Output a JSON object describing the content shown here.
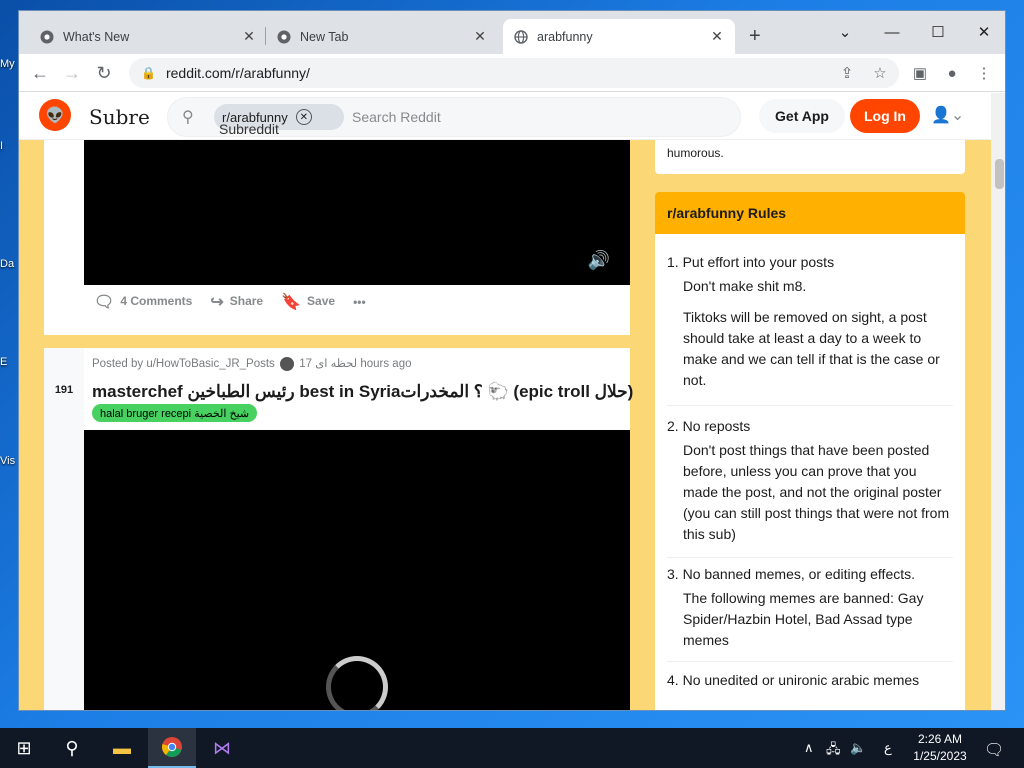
{
  "desktop": {
    "icons": [
      "My",
      "I",
      "Da",
      "E",
      "Vis"
    ]
  },
  "browser": {
    "tabs": [
      {
        "title": "What's New",
        "close": "✕"
      },
      {
        "title": "New Tab",
        "close": "✕"
      },
      {
        "title": "arabfunny",
        "close": "✕"
      }
    ],
    "new_tab": "+",
    "controls": {
      "minimize": "⌄",
      "restore": "—",
      "maximize": "☐",
      "close": "✕"
    },
    "url": "reddit.com/r/arabfunny/"
  },
  "reddit": {
    "header": {
      "logo": "👽",
      "wordmark": "Subre",
      "search_chip": "r/arabfunny",
      "search_chip_alt": "Subreddit Icon",
      "search_placeholder": "Search Reddit",
      "get_app": "Get App",
      "login": "Log In"
    },
    "post1": {
      "comments": "4 Comments",
      "share": "Share",
      "save": "Save",
      "more": "•••"
    },
    "post2": {
      "votes": "191",
      "posted_by": "Posted by u/HowToBasic_JR_Posts",
      "flair_text": "لحظه ای",
      "time": "17 hours ago",
      "title": "masterchef رئيس الطباخين best in Syria؟ المخدرات 🐑 (epic troll حلال)",
      "post_flair": "halal bruger recepi شيخ الخصية"
    },
    "sidebar": {
      "about_tail": "humorous.",
      "rules_title": "r/arabfunny Rules",
      "rules": [
        {
          "num": "1.",
          "title": "Put effort into your posts",
          "desc": [
            "Don't make shit m8.",
            "Tiktoks will be removed on sight, a post should take at least a day to a week to make and we can tell if that is the case or not."
          ]
        },
        {
          "num": "2.",
          "title": "No reposts",
          "desc": [
            "Don't post things that have been posted before, unless you can prove that you made the post, and not the original poster (you can still post things that were not from this sub)"
          ]
        },
        {
          "num": "3.",
          "title": "No banned memes, or editing effects.",
          "desc": [
            "The following memes are banned: Gay Spider/Hazbin Hotel, Bad Assad type memes"
          ]
        },
        {
          "num": "4.",
          "title": "No unedited or unironic arabic memes",
          "desc": []
        }
      ]
    }
  },
  "taskbar": {
    "tray_lang": "ع",
    "time": "2:26 AM",
    "date": "1/25/2023"
  }
}
